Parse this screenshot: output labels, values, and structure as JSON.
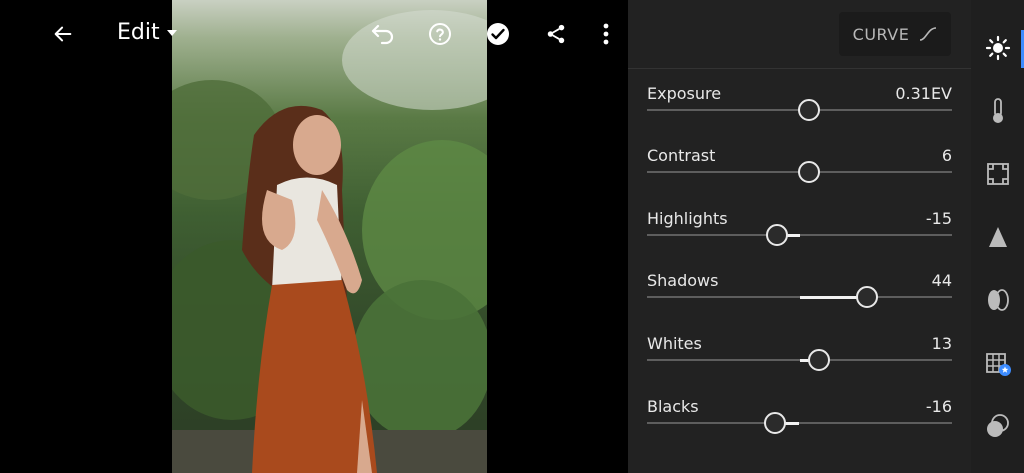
{
  "topbar": {
    "edit_label": "Edit"
  },
  "panel": {
    "curve_label": "CURVE",
    "sliders": [
      {
        "label": "Exposure",
        "value": "0.31EV",
        "position": 0.53
      },
      {
        "label": "Contrast",
        "value": "6",
        "position": 0.53
      },
      {
        "label": "Highlights",
        "value": "-15",
        "position": 0.425
      },
      {
        "label": "Shadows",
        "value": "44",
        "position": 0.72
      },
      {
        "label": "Whites",
        "value": "13",
        "position": 0.565
      },
      {
        "label": "Blacks",
        "value": "-16",
        "position": 0.42
      }
    ]
  },
  "tools": [
    "light-icon",
    "color-icon",
    "crop-icon",
    "detail-icon",
    "optics-icon",
    "presets-icon",
    "mask-icon"
  ],
  "colors": {
    "accent": "#3d8cff",
    "panel": "#222222"
  }
}
